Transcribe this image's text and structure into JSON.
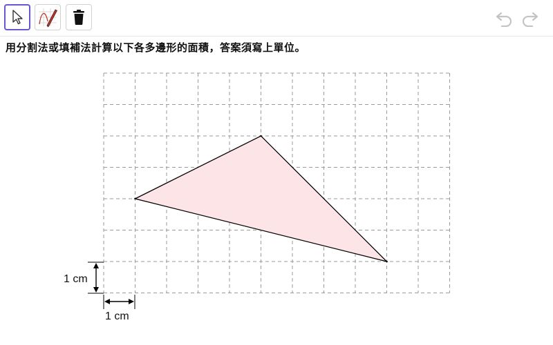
{
  "toolbar": {
    "tools": [
      {
        "name": "move",
        "icon": "arrow-cursor-icon",
        "selected": true
      },
      {
        "name": "freehand",
        "icon": "pen-icon",
        "selected": false
      },
      {
        "name": "delete",
        "icon": "trash-icon",
        "selected": false
      }
    ],
    "undo_icon": "undo-icon",
    "redo_icon": "redo-icon"
  },
  "instruction": "用分割法或填補法計算以下各多邊形的面積，答案須寫上單位。",
  "grid": {
    "columns": 11,
    "rows": 7,
    "line_style": "dashed"
  },
  "triangle": {
    "vertices_grid": [
      [
        1,
        4
      ],
      [
        5,
        2
      ],
      [
        9,
        6
      ]
    ],
    "fill_color": "#fde4e6",
    "stroke_color": "#000000"
  },
  "scale": {
    "vertical_label": "1 cm",
    "horizontal_label": "1 cm"
  },
  "colors": {
    "accent": "#6557d2",
    "grid_line": "#9a9a9a",
    "icon_gray": "#c4c4c4"
  }
}
